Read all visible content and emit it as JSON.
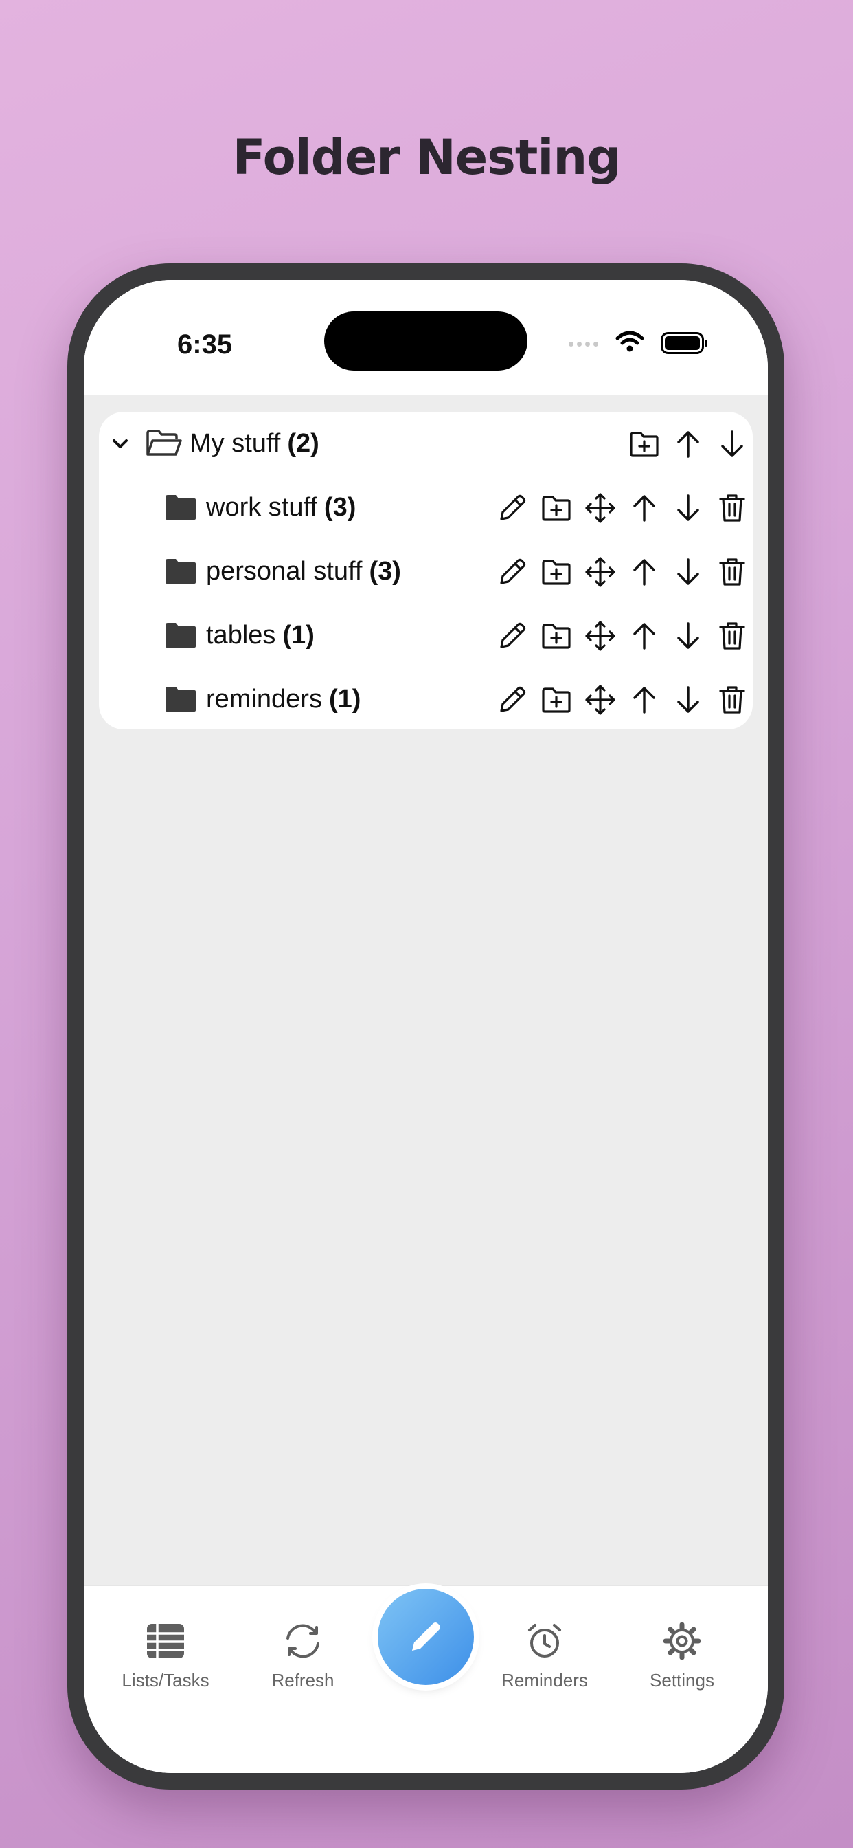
{
  "promo": {
    "title": "Folder Nesting"
  },
  "status_bar": {
    "time": "6:35"
  },
  "tree": {
    "root": {
      "name": "My stuff",
      "count": "(2)",
      "actions": [
        "add-folder-icon",
        "arrow-up-icon",
        "arrow-down-icon"
      ]
    },
    "children": [
      {
        "name": "work stuff",
        "count": "(3)"
      },
      {
        "name": "personal stuff",
        "count": "(3)"
      },
      {
        "name": "tables",
        "count": "(1)"
      },
      {
        "name": "reminders",
        "count": "(1)"
      }
    ],
    "child_actions": [
      "pencil-icon",
      "add-folder-icon",
      "move-icon",
      "arrow-up-icon",
      "arrow-down-icon",
      "trash-icon"
    ]
  },
  "tabbar": {
    "tabs": [
      {
        "label": "Lists/Tasks",
        "icon": "list-table-icon"
      },
      {
        "label": "Refresh",
        "icon": "refresh-icon"
      },
      {
        "label": "",
        "icon": "pencil-icon"
      },
      {
        "label": "Reminders",
        "icon": "alarm-clock-icon"
      },
      {
        "label": "Settings",
        "icon": "gear-icon"
      }
    ]
  },
  "colors": {
    "fab_start": "#7fc4f5",
    "fab_end": "#3d8fe8",
    "background_top": "#e3b3df",
    "background_bottom": "#c48ec6"
  }
}
